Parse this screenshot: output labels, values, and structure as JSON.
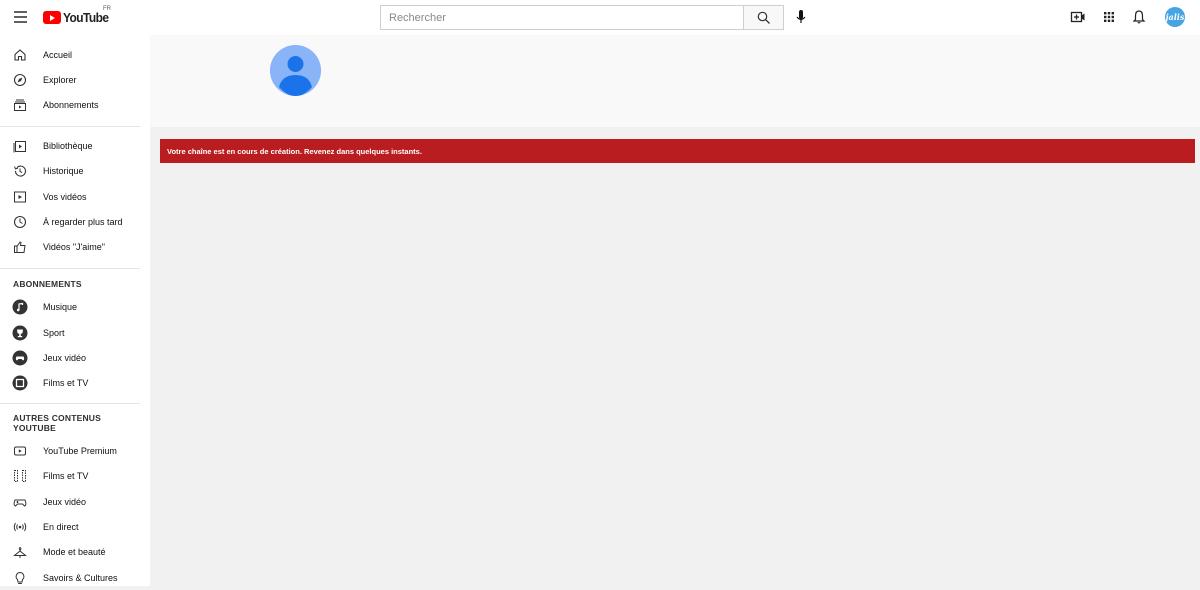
{
  "header": {
    "logo_text": "YouTube",
    "country_code": "FR",
    "search_placeholder": "Rechercher",
    "user_avatar_text": "jalis",
    "brand_color": "#ff0000"
  },
  "sidebar": {
    "main_items": [
      {
        "label": "Accueil",
        "icon": "home-icon"
      },
      {
        "label": "Explorer",
        "icon": "compass-icon"
      },
      {
        "label": "Abonnements",
        "icon": "subscriptions-icon"
      }
    ],
    "library_items": [
      {
        "label": "Bibliothèque",
        "icon": "library-icon"
      },
      {
        "label": "Historique",
        "icon": "history-icon"
      },
      {
        "label": "Vos vidéos",
        "icon": "your-videos-icon"
      },
      {
        "label": "À regarder plus tard",
        "icon": "watch-later-icon"
      },
      {
        "label": "Vidéos \"J'aime\"",
        "icon": "thumbs-up-icon"
      }
    ],
    "subscriptions_title": "ABONNEMENTS",
    "subscriptions": [
      {
        "label": "Musique",
        "icon": "music-channel-icon"
      },
      {
        "label": "Sport",
        "icon": "sport-channel-icon"
      },
      {
        "label": "Jeux vidéo",
        "icon": "gaming-channel-icon"
      },
      {
        "label": "Films et TV",
        "icon": "films-channel-icon"
      }
    ],
    "more_title_line1": "AUTRES CONTENUS",
    "more_title_line2": "YOUTUBE",
    "more_items": [
      {
        "label": "YouTube Premium",
        "icon": "premium-icon"
      },
      {
        "label": "Films et TV",
        "icon": "film-strip-icon"
      },
      {
        "label": "Jeux vidéo",
        "icon": "gamepad-icon"
      },
      {
        "label": "En direct",
        "icon": "live-icon"
      },
      {
        "label": "Mode et beauté",
        "icon": "hanger-icon"
      },
      {
        "label": "Savoirs & Cultures",
        "icon": "lightbulb-icon"
      }
    ]
  },
  "main": {
    "alert_text": "Votre chaîne est en cours de création. Revenez dans quelques instants.",
    "alert_color": "#b91d1f"
  }
}
